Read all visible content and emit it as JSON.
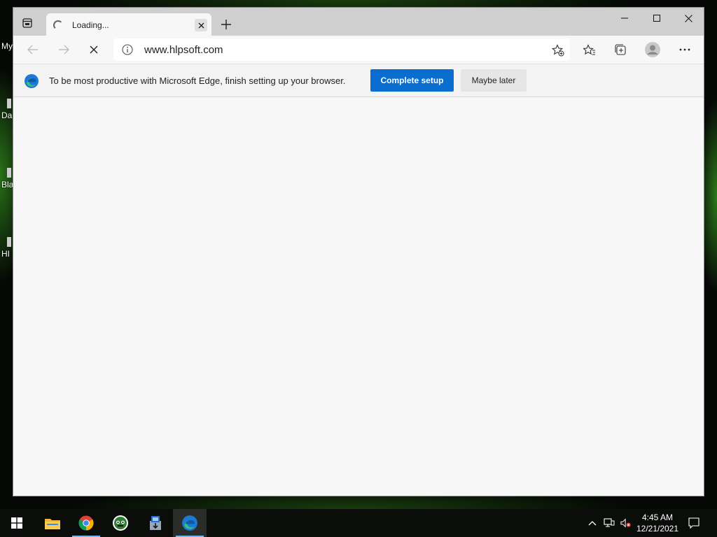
{
  "desktop": {
    "labels": [
      "My",
      "Da",
      "Bla",
      "HI"
    ]
  },
  "browser": {
    "tab": {
      "title": "Loading..."
    },
    "address": {
      "url": "www.hlpsoft.com"
    },
    "infobar": {
      "message": "To be most productive with Microsoft Edge, finish setting up your browser.",
      "primary_label": "Complete setup",
      "secondary_label": "Maybe later"
    }
  },
  "taskbar": {
    "apps": [
      "start-icon",
      "file-explorer-icon",
      "chrome-icon",
      "tor-bot-icon",
      "installer-icon",
      "edge-icon"
    ],
    "clock": {
      "time": "4:45 AM",
      "date": "12/21/2021"
    }
  },
  "colors": {
    "accent": "#0a6ed1",
    "taskbar_bg": "#0b0d0b",
    "desktop_glow": "#46c828"
  }
}
